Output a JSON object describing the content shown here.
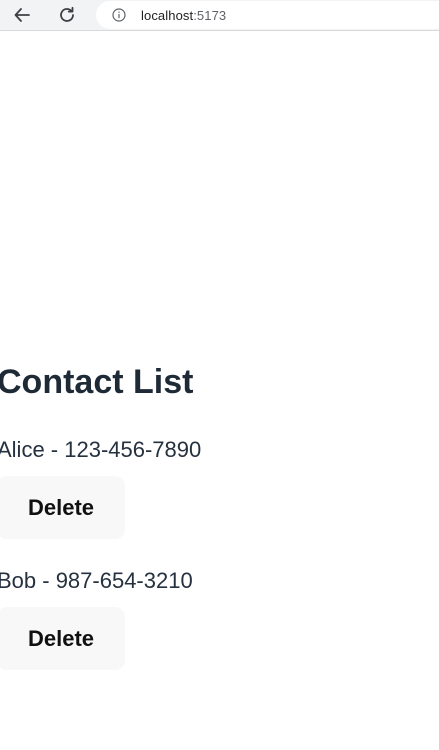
{
  "browser": {
    "url_host": "localhost",
    "url_port": ":5173",
    "icons": {
      "back": "back-arrow-icon",
      "reload": "reload-icon",
      "info": "info-icon"
    }
  },
  "main": {
    "title": "Contact List",
    "contacts": [
      {
        "text": "Alice - 123-456-7890",
        "delete_label": "Delete"
      },
      {
        "text": "Bob - 987-654-3210",
        "delete_label": "Delete"
      }
    ]
  },
  "colors": {
    "heading": "#1f2a37",
    "body_text": "#263140",
    "button_bg": "#f8f8f8",
    "button_text": "#111111"
  }
}
